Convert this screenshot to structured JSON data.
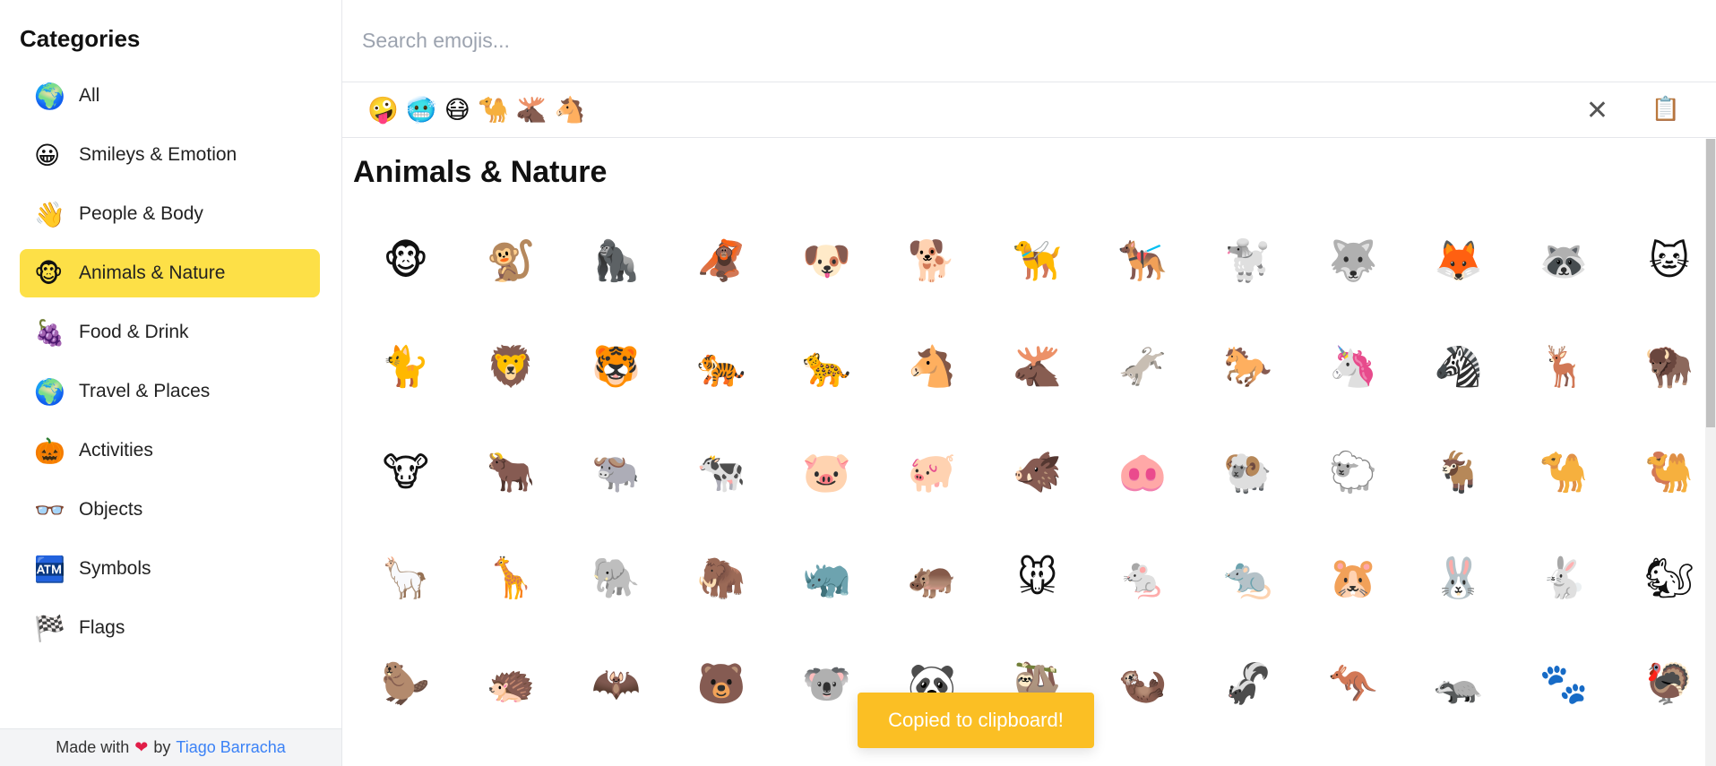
{
  "sidebar": {
    "title": "Categories",
    "items": [
      {
        "icon": "🌍",
        "icon_name": "globe-icon",
        "label": "All"
      },
      {
        "icon": "😀",
        "icon_name": "smiley-icon",
        "label": "Smileys & Emotion"
      },
      {
        "icon": "👋",
        "icon_name": "waving-hand-icon",
        "label": "People & Body"
      },
      {
        "icon": "🐵",
        "icon_name": "monkey-face-icon",
        "label": "Animals & Nature",
        "active": true
      },
      {
        "icon": "🍇",
        "icon_name": "grapes-icon",
        "label": "Food & Drink"
      },
      {
        "icon": "🌍",
        "icon_name": "globe-icon",
        "label": "Travel & Places"
      },
      {
        "icon": "🎃",
        "icon_name": "jack-o-lantern-icon",
        "label": "Activities"
      },
      {
        "icon": "👓",
        "icon_name": "glasses-icon",
        "label": "Objects"
      },
      {
        "icon": "🏧",
        "icon_name": "atm-icon",
        "label": "Symbols"
      },
      {
        "icon": "🏁",
        "icon_name": "checkered-flag-icon",
        "label": "Flags"
      }
    ]
  },
  "footer": {
    "made_with": "Made with",
    "heart": "❤",
    "by": "by",
    "author": "Tiago Barracha"
  },
  "search": {
    "placeholder": "Search emojis..."
  },
  "selected": {
    "emojis": [
      "🤪",
      "🥶",
      "😷",
      "🐪",
      "🫎",
      "🐴"
    ],
    "clear_icon": "✕",
    "copy_icon": "📋"
  },
  "section": {
    "title": "Animals & Nature",
    "emojis": [
      "🐵",
      "🐒",
      "🦍",
      "🦧",
      "🐶",
      "🐕",
      "🦮",
      "🐕‍🦺",
      "🐩",
      "🐺",
      "🦊",
      "🦝",
      "🐱",
      "🐈",
      "🦁",
      "🐯",
      "🐅",
      "🐆",
      "🐴",
      "🫎",
      "🫏",
      "🐎",
      "🦄",
      "🦓",
      "🦌",
      "🦬",
      "🐮",
      "🐂",
      "🐃",
      "🐄",
      "🐷",
      "🐖",
      "🐗",
      "🐽",
      "🐏",
      "🐑",
      "🐐",
      "🐪",
      "🐫",
      "🦙",
      "🦒",
      "🐘",
      "🦣",
      "🦏",
      "🦛",
      "🐭",
      "🐁",
      "🐀",
      "🐹",
      "🐰",
      "🐇",
      "🐿",
      "🦫",
      "🦔",
      "🦇",
      "🐻",
      "🐨",
      "🐼",
      "🦥",
      "🦦",
      "🦨",
      "🦘",
      "🦡",
      "🐾",
      "🦃"
    ]
  },
  "toast": {
    "text": "Copied to clipboard!"
  },
  "colors": {
    "accent": "#fde047",
    "toast": "#fbbf24",
    "link": "#3b82f6"
  }
}
